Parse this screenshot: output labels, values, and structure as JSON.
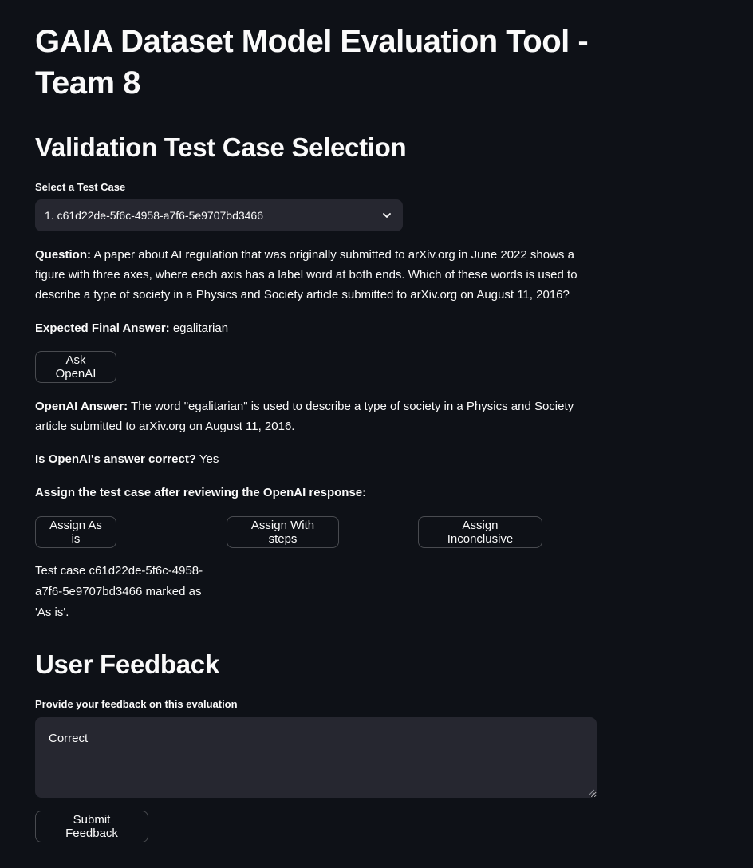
{
  "header": {
    "title": "GAIA Dataset Model Evaluation Tool - Team 8"
  },
  "selection": {
    "heading": "Validation Test Case Selection",
    "label": "Select a Test Case",
    "selected_value": "1. c61d22de-5f6c-4958-a7f6-5e9707bd3466"
  },
  "question": {
    "label": "Question:",
    "text": " A paper about AI regulation that was originally submitted to arXiv.org in June 2022 shows a figure with three axes, where each axis has a label word at both ends. Which of these words is used to describe a type of society in a Physics and Society article submitted to arXiv.org on August 11, 2016?"
  },
  "expected": {
    "label": "Expected Final Answer:",
    "value": " egalitarian"
  },
  "ask_button": "Ask OpenAI",
  "openai_answer": {
    "label": "OpenAI Answer:",
    "text": " The word \"egalitarian\" is used to describe a type of society in a Physics and Society article submitted to arXiv.org on August 11, 2016."
  },
  "correctness": {
    "label": "Is OpenAI's answer correct?",
    "value": " Yes"
  },
  "assign": {
    "heading": "Assign the test case after reviewing the OpenAI response:",
    "buttons": [
      "Assign As is",
      "Assign With steps",
      "Assign Inconclusive"
    ],
    "status": "Test case c61d22de-5f6c-4958-a7f6-5e9707bd3466 marked as 'As is'."
  },
  "feedback": {
    "heading": "User Feedback",
    "label": "Provide your feedback on this evaluation",
    "value": "Correct",
    "submit": "Submit Feedback"
  },
  "icons": {
    "dropdown": "chevron-down-icon"
  },
  "colors": {
    "background": "#0e1117",
    "input_background": "#262730",
    "text": "#fafafa"
  }
}
